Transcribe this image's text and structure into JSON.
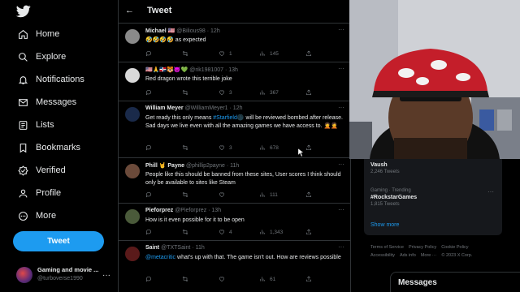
{
  "sidebar": {
    "items": [
      {
        "label": "Home",
        "icon": "home-icon"
      },
      {
        "label": "Explore",
        "icon": "search-icon"
      },
      {
        "label": "Notifications",
        "icon": "bell-icon"
      },
      {
        "label": "Messages",
        "icon": "mail-icon"
      },
      {
        "label": "Lists",
        "icon": "list-icon"
      },
      {
        "label": "Bookmarks",
        "icon": "bookmark-icon"
      },
      {
        "label": "Verified",
        "icon": "verified-icon"
      },
      {
        "label": "Profile",
        "icon": "profile-icon"
      },
      {
        "label": "More",
        "icon": "more-icon"
      }
    ],
    "tweet_button": "Tweet",
    "account": {
      "name": "Gaming and movie ...",
      "handle": "@turboverse1990"
    }
  },
  "header": {
    "title": "Tweet"
  },
  "tweets": [
    {
      "name": "Michael 🇺🇸",
      "handle": "@Bilious98 · 12h",
      "text": "🤣🤣🤣🤣 as expected",
      "replies": "",
      "retweets": "",
      "likes": "1",
      "views": "145",
      "colors": {
        "avatar": "#8a8a8a"
      }
    },
    {
      "name": "🇺🇸🙏🇩🇴🐯😈💚",
      "handle": "@rik1981007 · 13h",
      "text": "Red dragon wrote this terrible joke",
      "replies": "",
      "retweets": "",
      "likes": "3",
      "views": "367",
      "colors": {
        "avatar": "#d9d9d9"
      }
    },
    {
      "name": "William Meyer",
      "handle": "@WilliamMeyer1 · 12h",
      "text_pre": "Get ready this only means ",
      "text_tag": "#Starfield",
      "text_post": "🌑 will be reviewed bombed after release. Sad days we live even with all the amazing games we have access to. 🤦🤦",
      "replies": "",
      "retweets": "",
      "likes": "3",
      "views": "678",
      "colors": {
        "avatar": "#1a2a4a"
      }
    },
    {
      "name": "Phill 🤘 Payne",
      "handle": "@phillip2payne · 11h",
      "text": "People like this should be banned from these sites, User scores I think should only be available to sites like Steam",
      "replies": "",
      "retweets": "",
      "likes": "",
      "views": "111",
      "colors": {
        "avatar": "#6b4a3a"
      }
    },
    {
      "name": "Pieforprez",
      "handle": "@Pieforprez · 13h",
      "text": "How is it even possible for it to be open",
      "replies": "",
      "retweets": "",
      "likes": "4",
      "views": "1,343",
      "colors": {
        "avatar": "#4a5a3a"
      }
    },
    {
      "name": "Saint",
      "handle": "@TXTSaint · 11h",
      "text_tag": "@metacritic",
      "text_post": " what's up with that. The game isn't out. How are reviews possible",
      "replies": "",
      "retweets": "",
      "likes": "",
      "views": "61",
      "colors": {
        "avatar": "#5a1a1a"
      }
    }
  ],
  "trends": [
    {
      "category": "",
      "name": "Vaush",
      "count": "2,246 Tweets"
    },
    {
      "category": "Gaming · Trending",
      "name": "#RockstarGames",
      "count": "1,815 Tweets"
    }
  ],
  "show_more": "Show more",
  "footer": {
    "links": [
      "Terms of Service",
      "Privacy Policy",
      "Cookie Policy",
      "Accessibility",
      "Ads info",
      "More ···",
      "© 2023 X Corp."
    ]
  },
  "messages_bar": {
    "title": "Messages"
  },
  "colors": {
    "accent": "#1d9bf0",
    "background": "#000000",
    "muted": "#71767b",
    "text": "#e7e9ea"
  }
}
